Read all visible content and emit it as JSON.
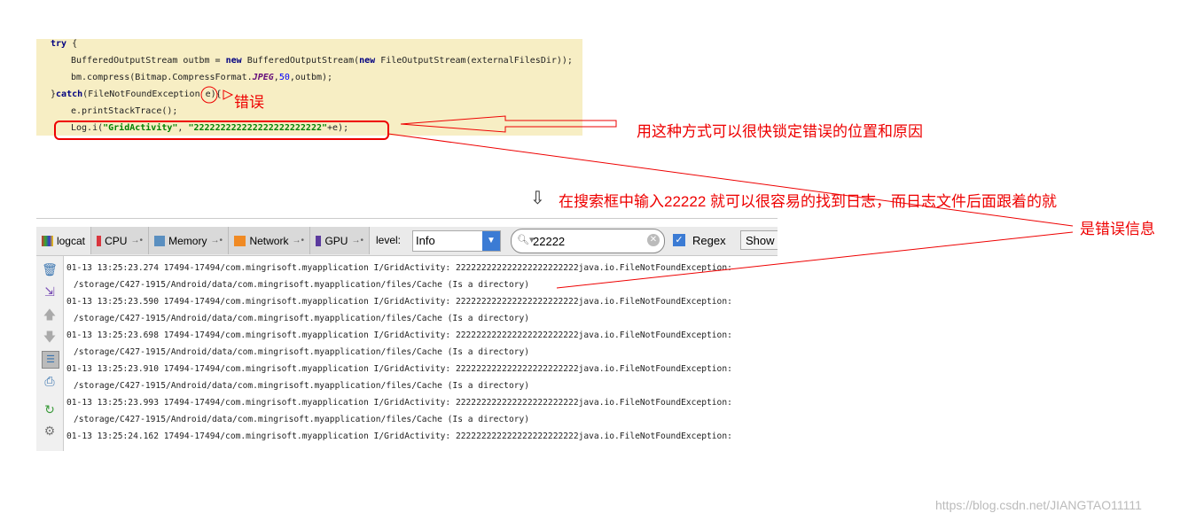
{
  "code": {
    "lines": [
      [
        "try",
        " {"
      ],
      [
        "BufferedOutputStream outbm = ",
        "new",
        " BufferedOutputStream(",
        "new",
        " FileOutputStream(externalFilesDir));"
      ],
      [
        "bm.compress(Bitmap.CompressFormat.",
        "JPEG",
        ",",
        "50",
        ",outbm);"
      ],
      [
        "}",
        "catch",
        "(FileNotFoundException e){"
      ],
      [
        "e.printStackTrace();"
      ],
      [
        "Log.i(",
        "\"GridActivity\"",
        ", ",
        "\"222222222222222222222222\"",
        "+e);"
      ]
    ]
  },
  "annotations": {
    "error": "错误",
    "locate": "用这种方式可以很快锁定错误的位置和原因",
    "search_hint_arrow": "⇩",
    "search_hint": "在搜索框中输入22222 就可以很容易的找到日志，而日志文件后面跟着的就",
    "search_hint_2": "是错误信息"
  },
  "logcat": {
    "tabs": [
      {
        "label": "logcat",
        "active": true
      },
      {
        "label": "CPU",
        "color": "#d9363e"
      },
      {
        "label": "Memory",
        "color": "#5a8fc0"
      },
      {
        "label": "Network",
        "color": "#f08a24"
      },
      {
        "label": "GPU",
        "color": "#5b3a9e"
      }
    ],
    "level_label": "level:",
    "level_value": "Info",
    "search_value": "22222",
    "regex_label": "Regex",
    "regex_checked": true,
    "show_label": "Show",
    "entries": [
      {
        "line1": "01-13 13:25:23.274 17494-17494/com.mingrisoft.myapplication I/GridActivity: 222222222222222222222222java.io.FileNotFoundException:",
        "line2": "/storage/C427-1915/Android/data/com.mingrisoft.myapplication/files/Cache (Is a directory)"
      },
      {
        "line1": "01-13 13:25:23.590 17494-17494/com.mingrisoft.myapplication I/GridActivity: 222222222222222222222222java.io.FileNotFoundException:",
        "line2": "/storage/C427-1915/Android/data/com.mingrisoft.myapplication/files/Cache (Is a directory)"
      },
      {
        "line1": "01-13 13:25:23.698 17494-17494/com.mingrisoft.myapplication I/GridActivity: 222222222222222222222222java.io.FileNotFoundException:",
        "line2": "/storage/C427-1915/Android/data/com.mingrisoft.myapplication/files/Cache (Is a directory)"
      },
      {
        "line1": "01-13 13:25:23.910 17494-17494/com.mingrisoft.myapplication I/GridActivity: 222222222222222222222222java.io.FileNotFoundException:",
        "line2": "/storage/C427-1915/Android/data/com.mingrisoft.myapplication/files/Cache (Is a directory)"
      },
      {
        "line1": "01-13 13:25:23.993 17494-17494/com.mingrisoft.myapplication I/GridActivity: 222222222222222222222222java.io.FileNotFoundException:",
        "line2": "/storage/C427-1915/Android/data/com.mingrisoft.myapplication/files/Cache (Is a directory)"
      },
      {
        "line1": "01-13 13:25:24.162 17494-17494/com.mingrisoft.myapplication I/GridActivity: 222222222222222222222222java.io.FileNotFoundException:",
        "line2": ""
      }
    ],
    "side_icons": [
      "trash-icon",
      "scroll-to-end-icon",
      "up-arrow-icon",
      "down-arrow-icon",
      "soft-wrap-icon",
      "print-icon",
      "restart-icon",
      "settings-icon"
    ]
  },
  "watermark": "https://blog.csdn.net/JIANGTAO11111"
}
